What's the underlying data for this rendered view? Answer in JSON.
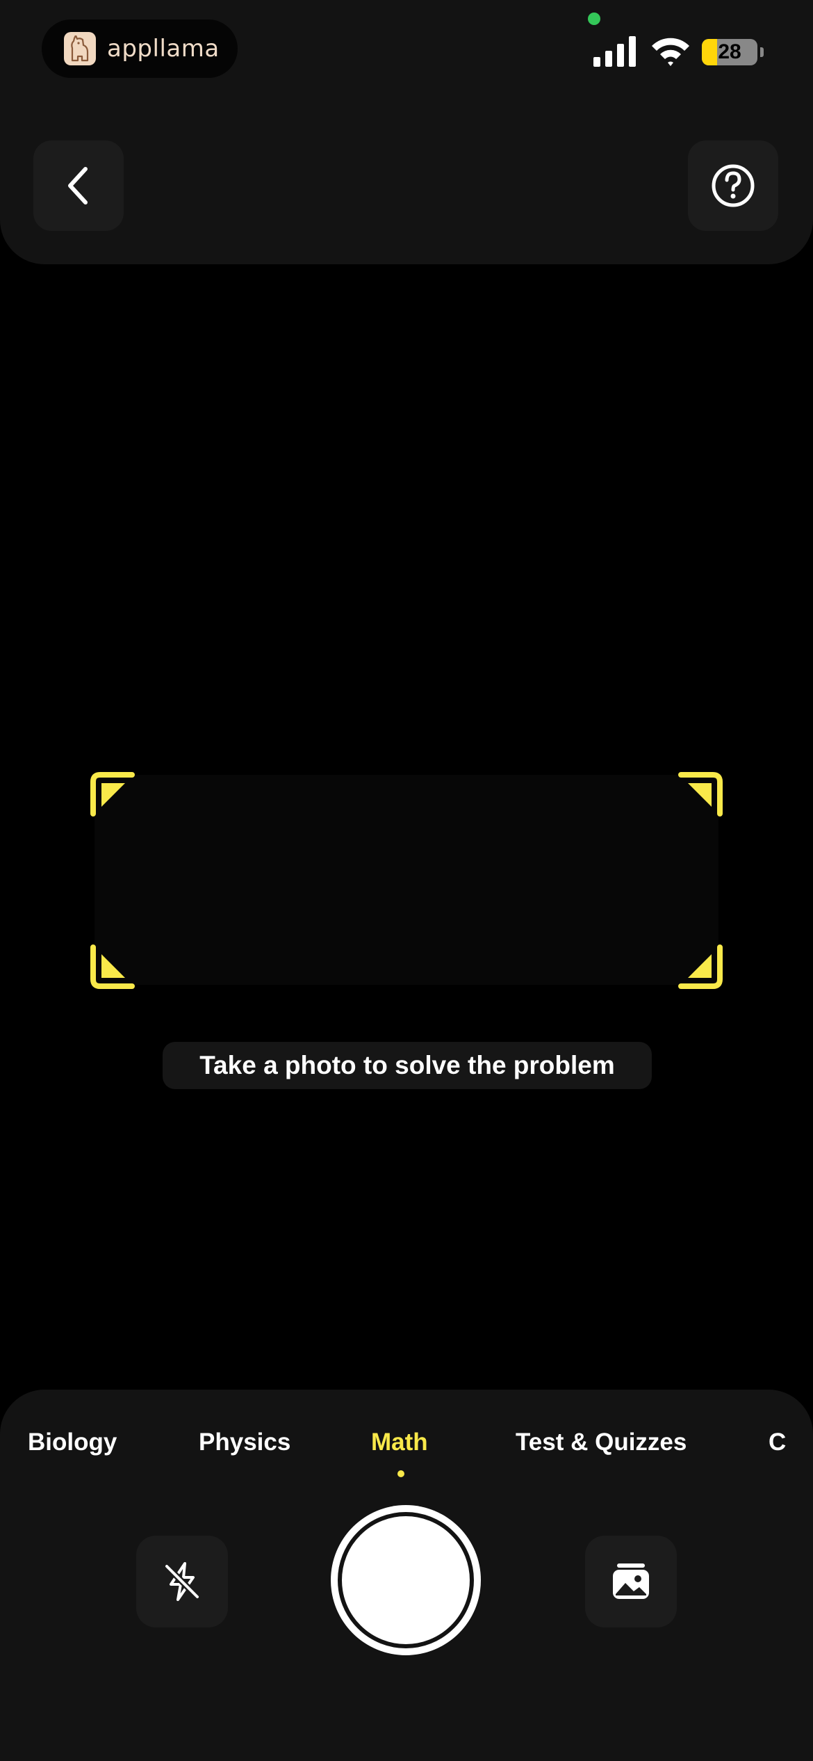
{
  "app": {
    "name": "appllama"
  },
  "status_bar": {
    "battery_level": "28",
    "battery_fraction": 0.28,
    "signal_icon": "cellular-signal-icon",
    "wifi_icon": "wifi-icon"
  },
  "header": {
    "back_icon": "chevron-left-icon",
    "help_icon": "question-circle-icon"
  },
  "camera": {
    "hint": "Take a photo to solve the problem"
  },
  "subjects": {
    "tabs": [
      {
        "label": "Biology",
        "active": false
      },
      {
        "label": "Physics",
        "active": false
      },
      {
        "label": "Math",
        "active": true
      },
      {
        "label": "Test & Quizzes",
        "active": false
      },
      {
        "label": "C",
        "active": false
      }
    ]
  },
  "controls": {
    "flash_icon": "flash-off-icon",
    "gallery_icon": "photo-gallery-icon"
  },
  "colors": {
    "accent": "#f9e94a",
    "background": "#000000",
    "panel": "#131313",
    "button": "#1c1c1c",
    "status_green": "#34c759",
    "battery": "#ffd60a"
  }
}
